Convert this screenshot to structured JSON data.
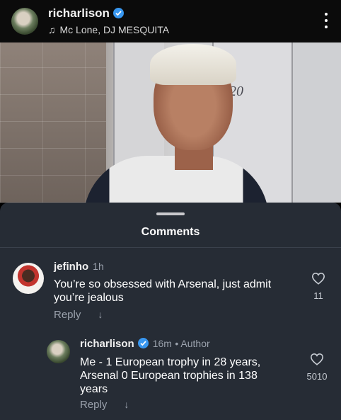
{
  "header": {
    "username": "richarlison",
    "music": "Mc Lone, DJ MESQUITA",
    "more_icon": "more-vertical-icon"
  },
  "photo": {
    "jersey_number": "20"
  },
  "comments_sheet": {
    "title": "Comments",
    "comments": [
      {
        "author": "jefinho",
        "time": "1h",
        "text": "You’re so obsessed with Arsenal, just admit you’re jealous",
        "reply_label": "Reply",
        "likes": "11"
      },
      {
        "author": "richarlison",
        "time": "16m",
        "badge": "• Author",
        "text": "Me - 1 European trophy in 28 years, Arsenal 0 European trophies in 138 years",
        "reply_label": "Reply",
        "likes": "5010"
      }
    ]
  },
  "colors": {
    "sheet_bg": "#262c35",
    "verified_blue": "#3897f0",
    "muted_text": "#9ba2ad"
  }
}
